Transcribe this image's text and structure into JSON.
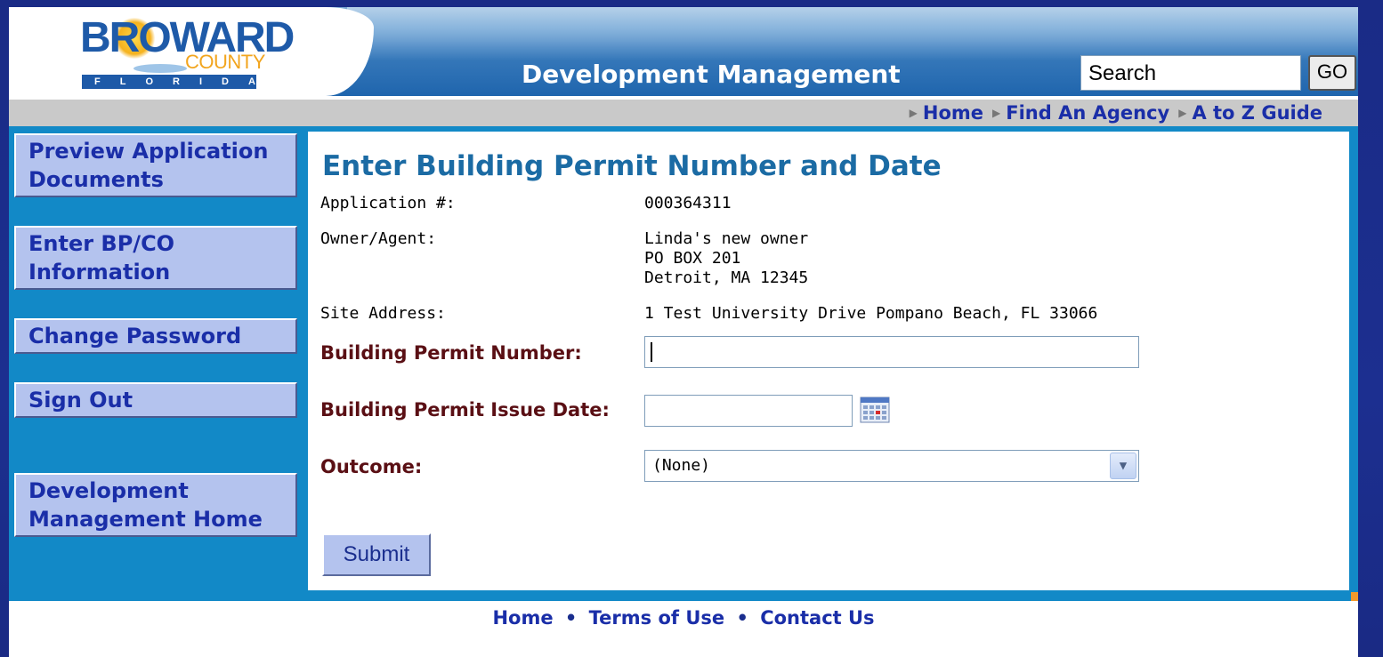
{
  "header": {
    "logo": {
      "line1": "BROWARD",
      "line2": "COUNTY",
      "line3": "FLORIDA"
    },
    "title": "Development Management",
    "search": {
      "value": "Search"
    },
    "go_label": "GO"
  },
  "nav": {
    "links": [
      "Home",
      "Find An Agency",
      "A to Z Guide"
    ]
  },
  "sidebar": {
    "items": [
      {
        "label": "Preview Application Documents"
      },
      {
        "label": "Enter BP/CO Information"
      },
      {
        "label": "Change Password"
      },
      {
        "label": "Sign Out"
      },
      {
        "label": "Development Management Home"
      }
    ]
  },
  "main": {
    "title": "Enter Building Permit Number and Date",
    "info": [
      {
        "label": "Application #:",
        "value": "000364311"
      },
      {
        "label": "Owner/Agent:",
        "value": [
          "Linda's new owner",
          "PO BOX 201",
          "Detroit, MA 12345"
        ]
      },
      {
        "label": "Site Address:",
        "value": "1 Test University Drive Pompano Beach, FL 33066"
      }
    ],
    "form": {
      "permit_number_label": "Building Permit Number:",
      "permit_number_value": "",
      "issue_date_label": "Building Permit Issue Date:",
      "issue_date_value": "",
      "outcome_label": "Outcome:",
      "outcome_value": "(None)",
      "submit_label": "Submit"
    }
  },
  "footer": {
    "links": [
      "Home",
      "Terms of Use",
      "Contact Us"
    ],
    "separator": "•"
  },
  "icons": {
    "calendar": "calendar-icon",
    "dropdown": "chevron-down-icon",
    "nav_arrow": "triangle-right-icon"
  }
}
